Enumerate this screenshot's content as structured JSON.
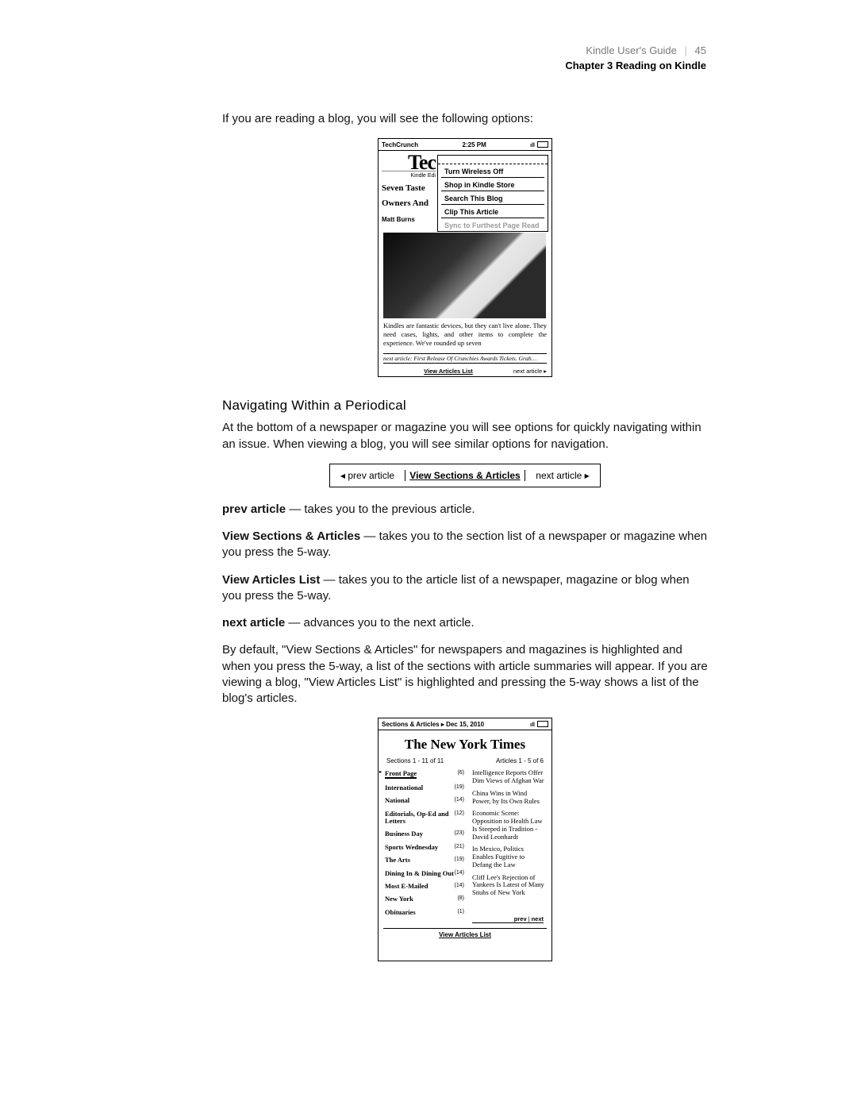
{
  "header": {
    "guide": "Kindle User's Guide",
    "page_number": "45",
    "chapter": "Chapter 3 Reading on Kindle"
  },
  "intro_text": "If you are reading a blog, you will see the following options:",
  "screenshot1": {
    "title_left": "TechCrunch",
    "time": "2:25 PM",
    "logo_text": "Tec",
    "kindle_edition": "Kindle Edi",
    "headline_line1": "Seven Taste",
    "headline_line2": "Owners And",
    "byline": "Matt Burns",
    "menu_items": [
      "Turn Wireless Off",
      "Shop in Kindle Store",
      "Search This Blog",
      "Clip This Article",
      "Sync to Furthest Page Read"
    ],
    "caption": "Kindles are fantastic devices, but they can't live alone. They need cases, lights, and other items to complete the experience. We've rounded up seven",
    "next_article_line": "next article: First Release Of Crunchies Awards Tickets. Grab…",
    "footer_mid": "View Articles List",
    "footer_right": "next article ▸"
  },
  "heading_nav": "Navigating Within a Periodical",
  "nav_intro": "At the bottom of a newspaper or magazine you will see options for quickly navigating within an issue. When viewing a blog, you will see similar options for navigation.",
  "navbar": {
    "prev": "prev article",
    "center": "View Sections & Articles",
    "next": "next article"
  },
  "defs": {
    "prev_term": "prev article",
    "prev_desc": " — takes you to the previous article.",
    "vsa_term": "View Sections & Articles",
    "vsa_desc": " — takes you to the section list of a newspaper or magazine when you press the 5-way.",
    "val_term": "View Articles List",
    "val_desc": " — takes you to the article list of a newspaper, magazine or blog when you press the 5-way.",
    "next_term": "next article",
    "next_desc": " — advances you to the next article."
  },
  "default_para": "By default, \"View Sections & Articles\" for newspapers and magazines is highlighted and when you press the 5-way, a list of the sections with article summaries will appear. If you are viewing a blog, \"View Articles List\" is highlighted and pressing the 5-way shows a list of the blog's articles.",
  "screenshot2": {
    "title_left": "Sections & Articles  ▸  Dec 15, 2010",
    "masthead": "The New York Times",
    "sections_label": "Sections 1 - 11 of 11",
    "articles_label": "Articles 1 - 5 of 6",
    "sections": [
      {
        "name": "Front Page",
        "count": "(6)",
        "active": true
      },
      {
        "name": "International",
        "count": "(19)"
      },
      {
        "name": "National",
        "count": "(14)"
      },
      {
        "name": "Editorials, Op-Ed and Letters",
        "count": "(12)"
      },
      {
        "name": "Business Day",
        "count": "(23)"
      },
      {
        "name": "Sports Wednesday",
        "count": "(21)"
      },
      {
        "name": "The Arts",
        "count": "(19)"
      },
      {
        "name": "Dining In & Dining Out",
        "count": "(14)"
      },
      {
        "name": "Most E-Mailed",
        "count": "(14)"
      },
      {
        "name": "New York",
        "count": "(8)"
      },
      {
        "name": "Obituaries",
        "count": "(1)"
      }
    ],
    "articles": [
      "Intelligence Reports Offer Dim Views of Afghan War",
      "China Wins in Wind Power, by Its Own Rules",
      "Economic Scene: Opposition to Health Law Is Steeped in Tradition - David Leonhardt",
      "In Mexico, Politics Enables Fugitive to Defang the Law",
      "Cliff Lee's Rejection of Yankees Is Latest of Many Snubs of New York"
    ],
    "prev": "prev",
    "next": "next",
    "footer": "View Articles List"
  }
}
